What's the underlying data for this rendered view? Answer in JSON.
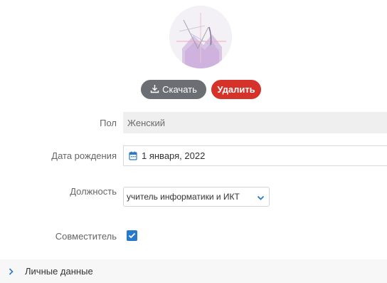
{
  "photo": {
    "download_label": "Скачать",
    "delete_label": "Удалить"
  },
  "form": {
    "gender": {
      "label": "Пол",
      "value": "Женский"
    },
    "birth_date": {
      "label": "Дата рождения",
      "value": "1 января, 2022"
    },
    "position": {
      "label": "Должность",
      "value": "учитель информатики и ИКТ"
    },
    "part_time": {
      "label": "Совместитель",
      "checked": true
    }
  },
  "sections": {
    "personal_data": {
      "label": "Личные данные"
    }
  },
  "colors": {
    "download_button": "#6b6f74",
    "delete_button": "#d5322a",
    "checkbox": "#2a79c9",
    "calendar_icon": "#2a79c9"
  }
}
